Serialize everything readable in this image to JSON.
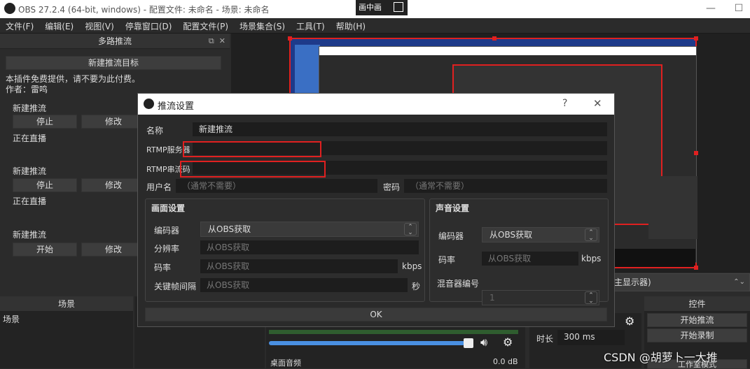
{
  "window": {
    "title": "OBS 27.2.4 (64-bit, windows) - 配置文件: 未命名 - 场景: 未命名",
    "pip_label": "画中画"
  },
  "menu": [
    "文件(F)",
    "编辑(E)",
    "视图(V)",
    "停靠窗口(D)",
    "配置文件(P)",
    "场景集合(S)",
    "工具(T)",
    "帮助(H)"
  ],
  "dock": {
    "title": "多路推流",
    "new_target": "新建推流目标",
    "notice": "本插件免费提供，请不要为此付费。",
    "author": "作者：雷鸣",
    "streams": [
      {
        "name": "新建推流",
        "btn1": "停止",
        "btn2": "修改",
        "status": "正在直播"
      },
      {
        "name": "新建推流",
        "btn1": "停止",
        "btn2": "修改",
        "status": "正在直播"
      },
      {
        "name": "新建推流",
        "btn1": "开始",
        "btn2": "修改",
        "status": ""
      }
    ]
  },
  "bottom": {
    "scenes_title": "场景",
    "scenes_item": "场景",
    "controls_title": "控件",
    "start_stream": "开始推流",
    "start_record": "开始录制",
    "studio_mode": "工作室模式",
    "display_combo": "主显示器)",
    "duration_label": "时长",
    "duration_value": "300 ms",
    "mixer_label": "桌面音频",
    "mixer_value": "0.0 dB"
  },
  "modal": {
    "title": "推流设置",
    "help": "?",
    "close": "✕",
    "name_label": "名称",
    "name_value": "新建推流",
    "server_label": "RTMP服务器",
    "key_label": "RTMP串流码",
    "user_label": "用户名",
    "user_placeholder": "（通常不需要）",
    "pass_label": "密码",
    "pass_placeholder": "（通常不需要）",
    "video": {
      "title": "画面设置",
      "encoder_label": "编码器",
      "encoder_value": "从OBS获取",
      "res_label": "分辨率",
      "res_placeholder": "从OBS获取",
      "bitrate_label": "码率",
      "bitrate_placeholder": "从OBS获取",
      "bitrate_unit": "kbps",
      "keyint_label": "关键帧间隔",
      "keyint_placeholder": "从OBS获取",
      "keyint_unit": "秒"
    },
    "audio": {
      "title": "声音设置",
      "encoder_label": "编码器",
      "encoder_value": "从OBS获取",
      "bitrate_label": "码率",
      "bitrate_placeholder": "从OBS获取",
      "bitrate_unit": "kbps",
      "mixer_label": "混音器编号",
      "mixer_value": "1"
    },
    "ok": "OK"
  },
  "watermark": "CSDN @胡萝卜一大推"
}
